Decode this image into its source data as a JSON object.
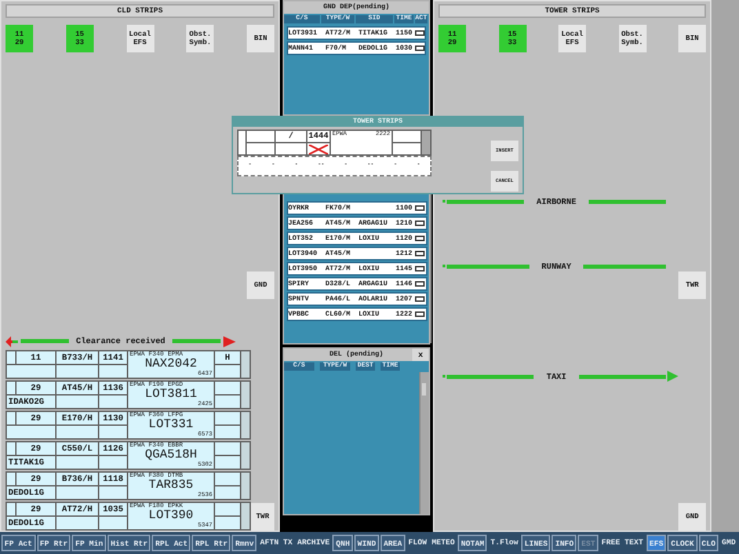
{
  "cld_strips": {
    "title": "CLD STRIPS",
    "buttons": [
      {
        "label": "11\n29",
        "active": true
      },
      {
        "label": "15\n33",
        "active": true
      },
      {
        "label": "Local\nEFS",
        "active": false
      },
      {
        "label": "Obst.\nSymb.",
        "active": false
      },
      {
        "label": "BIN",
        "active": false
      }
    ],
    "gnd_button": "GND",
    "clearance_bar": "Clearance received",
    "twr_button": "TWR",
    "strips": [
      {
        "rwy": "11",
        "type": "B733/H",
        "time": "1141",
        "extra": "H",
        "route": "EPWA F340 EPMA",
        "callsign": "NAX2042",
        "squawk": "6437"
      },
      {
        "rwy": "29",
        "type": "AT45/H",
        "time": "1136",
        "sid": "IDAKO2G",
        "route": "EPWA F190 EPGD",
        "callsign": "LOT3811",
        "squawk": "2425"
      },
      {
        "rwy": "29",
        "type": "E170/H",
        "time": "1130",
        "route": "EPWA F360 LFPG",
        "callsign": "LOT331",
        "squawk": "6573"
      },
      {
        "rwy": "29",
        "type": "C550/L",
        "time": "1126",
        "sid": "TITAK1G",
        "route": "EPWA F340 EBBR",
        "callsign": "QGA518H",
        "squawk": "5302"
      },
      {
        "rwy": "29",
        "type": "B736/H",
        "time": "1118",
        "sid": "DEDOL1G",
        "route": "EPWA F380 DTMB",
        "callsign": "TAR835",
        "squawk": "2536"
      },
      {
        "rwy": "29",
        "type": "AT72/H",
        "time": "1035",
        "sid": "DEDOL1G",
        "route": "EPWA F180 EPKK",
        "callsign": "LOT390",
        "squawk": "5347"
      }
    ]
  },
  "gnd_dep": {
    "title": "GND DEP(pending)",
    "columns": [
      "C/S",
      "TYPE/W",
      "SID",
      "TIME",
      "ACT"
    ],
    "rows": [
      {
        "cs": "LOT3931",
        "type": "AT72/M",
        "sid": "TITAK1G",
        "time": "1150",
        "checked": false
      },
      {
        "cs": "MANN41",
        "type": "F70/M",
        "sid": "DEDOL1G",
        "time": "1030",
        "checked": false
      }
    ]
  },
  "dep_list": {
    "rows": [
      {
        "cs": "OYRKR",
        "type": "FK70/M",
        "time": "1100",
        "checked": false
      },
      {
        "cs": "JEA256",
        "type": "AT45/M",
        "sid": "ARGAG1U",
        "time": "1210",
        "checked": false
      },
      {
        "cs": "LOT352",
        "type": "E170/M",
        "sid": "LOXIU",
        "time": "1120",
        "checked": false
      },
      {
        "cs": "LOT3940",
        "type": "AT45/M",
        "time": "1212",
        "checked": false
      },
      {
        "cs": "LOT3950",
        "type": "AT72/M",
        "sid": "LOXIU",
        "time": "1145",
        "checked": false
      },
      {
        "cs": "SPIRY",
        "type": "D328/L",
        "sid": "ARGAG1U",
        "time": "1146",
        "checked": false
      },
      {
        "cs": "SPNTV",
        "type": "PA46/L",
        "sid": "AOLAR1U",
        "time": "1207",
        "checked": false
      },
      {
        "cs": "VPBBC",
        "type": "CL60/M",
        "sid": "LOXIU",
        "time": "1222",
        "checked": false
      }
    ]
  },
  "del": {
    "title": "DEL (pending)",
    "close": "x",
    "columns": [
      "C/S",
      "TYPE/W",
      "DEST",
      "TIME"
    ]
  },
  "tower_strips": {
    "title": "TOWER STRIPS",
    "buttons": [
      {
        "label": "11\n29",
        "active": true
      },
      {
        "label": "15\n33",
        "active": true
      },
      {
        "label": "Local\nEFS",
        "active": false
      },
      {
        "label": "Obst.\nSymb.",
        "active": false
      },
      {
        "label": "BIN",
        "active": false
      }
    ],
    "lanes": [
      {
        "label": "AIRBORNE",
        "kind": "plain"
      },
      {
        "label": "RUNWAY",
        "kind": "plain"
      },
      {
        "label": "TAXI",
        "kind": "arrow"
      }
    ],
    "twr_button": "TWR",
    "gnd_button": "GND"
  },
  "dialog": {
    "title": "TOWER STRIPS",
    "strip": {
      "slash": "/",
      "code": "1444",
      "cancelled": true,
      "dep": "EPWA",
      "squawk": "2222"
    },
    "marks": [
      "-",
      "-",
      "-",
      "--",
      "-",
      "--",
      "-",
      "-"
    ],
    "buttons": [
      "INSERT",
      "CANCEL"
    ]
  },
  "toolbar": [
    {
      "label": "FP Act",
      "boxed": true,
      "selected": false,
      "disabled": false
    },
    {
      "label": "FP Rtr",
      "boxed": true,
      "selected": false,
      "disabled": false
    },
    {
      "label": "FP Min",
      "boxed": true,
      "selected": false,
      "disabled": false
    },
    {
      "label": "Hist Rtr",
      "boxed": true,
      "selected": false,
      "disabled": false
    },
    {
      "label": "RPL Act",
      "boxed": true,
      "selected": false,
      "disabled": false
    },
    {
      "label": "RPL Rtr",
      "boxed": true,
      "selected": false,
      "disabled": false
    },
    {
      "label": "Rmnv",
      "boxed": true,
      "selected": false,
      "disabled": false
    },
    {
      "label": "AFTN TX",
      "boxed": false,
      "selected": false,
      "disabled": false
    },
    {
      "label": "ARCHIVE",
      "boxed": false,
      "selected": false,
      "disabled": false
    },
    {
      "label": "QNH",
      "boxed": true,
      "selected": false,
      "disabled": false
    },
    {
      "label": "WIND",
      "boxed": true,
      "selected": false,
      "disabled": false
    },
    {
      "label": "AREA",
      "boxed": true,
      "selected": false,
      "disabled": false
    },
    {
      "label": "FLOW",
      "boxed": false,
      "selected": false,
      "disabled": false
    },
    {
      "label": "METEO",
      "boxed": false,
      "selected": false,
      "disabled": false
    },
    {
      "label": "NOTAM",
      "boxed": true,
      "selected": false,
      "disabled": false
    },
    {
      "label": "T.Flow",
      "boxed": false,
      "selected": false,
      "disabled": false
    },
    {
      "label": "LINES",
      "boxed": true,
      "selected": false,
      "disabled": false
    },
    {
      "label": "INFO",
      "boxed": true,
      "selected": false,
      "disabled": false
    },
    {
      "label": "EST",
      "boxed": true,
      "selected": false,
      "disabled": true
    },
    {
      "label": "FREE TEXT",
      "boxed": false,
      "selected": false,
      "disabled": false
    },
    {
      "label": "EFS",
      "boxed": true,
      "selected": true,
      "disabled": false
    },
    {
      "label": "CLOCK",
      "boxed": true,
      "selected": false,
      "disabled": false
    },
    {
      "label": "CLO",
      "boxed": true,
      "selected": false,
      "disabled": false
    },
    {
      "label": "GMD",
      "boxed": false,
      "selected": false,
      "disabled": false
    }
  ]
}
